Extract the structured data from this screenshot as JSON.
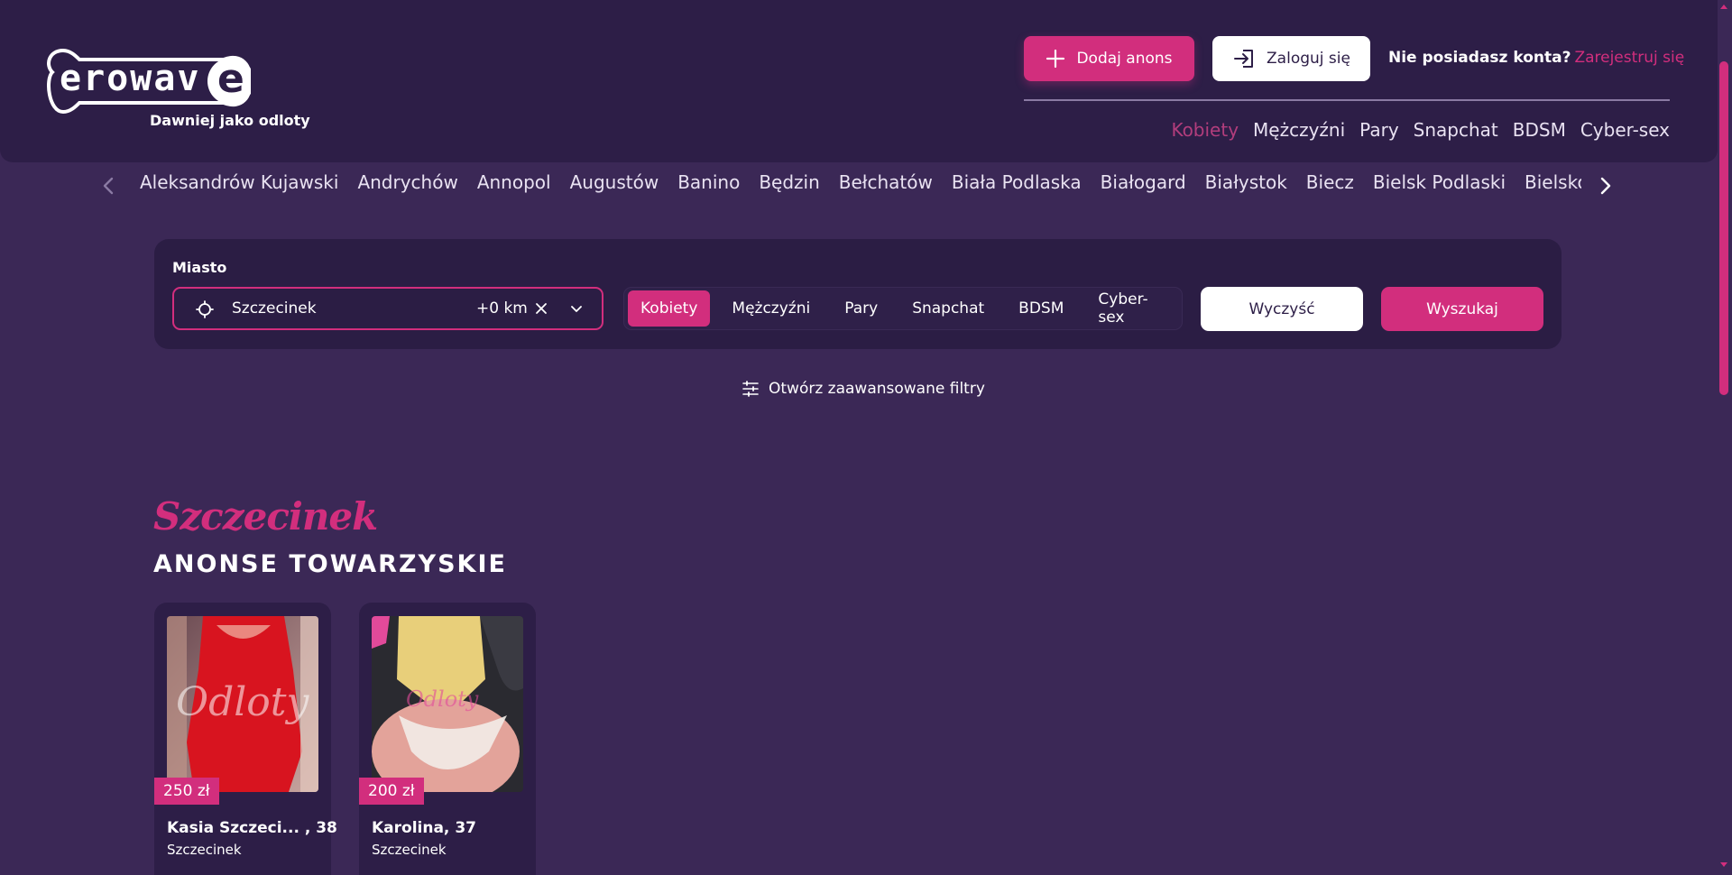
{
  "header": {
    "logo_text": "erowave",
    "logo_subtitle": "Dawniej jako odloty",
    "add_button": "Dodaj anons",
    "login_button": "Zaloguj się",
    "no_account": "Nie posiadasz konta?",
    "register_link": "Zarejestruj się",
    "nav": [
      "Kobiety",
      "Mężczyźni",
      "Pary",
      "Snapchat",
      "BDSM",
      "Cyber-sex"
    ],
    "nav_active": "Kobiety"
  },
  "cities": [
    "Aleksandrów Kujawski",
    "Andrychów",
    "Annopol",
    "Augustów",
    "Banino",
    "Będzin",
    "Bełchatów",
    "Biała Podlaska",
    "Białogard",
    "Białystok",
    "Biecz",
    "Bielsk Podlaski",
    "Bielsko-Biała"
  ],
  "search": {
    "city_label": "Miasto",
    "city_value": "Szczecinek",
    "radius": "+0 km",
    "categories": [
      "Kobiety",
      "Mężczyźni",
      "Pary",
      "Snapchat",
      "BDSM",
      "Cyber-sex"
    ],
    "active_category": "Kobiety",
    "clear_button": "Wyczyść",
    "search_button": "Wyszukaj",
    "advanced_filters": "Otwórz zaawansowane filtry"
  },
  "section": {
    "city_title": "Szczecinek",
    "title": "ANONSE TOWARZYSKIE"
  },
  "listings": [
    {
      "price": "250 zł",
      "name": "Kasia Szczeci... , 38",
      "city": "Szczecinek"
    },
    {
      "price": "200 zł",
      "name": "Karolina, 37",
      "city": "Szczecinek"
    }
  ],
  "colors": {
    "background": "#3b2856",
    "header": "#2d1e47",
    "accent": "#d22e7d"
  }
}
